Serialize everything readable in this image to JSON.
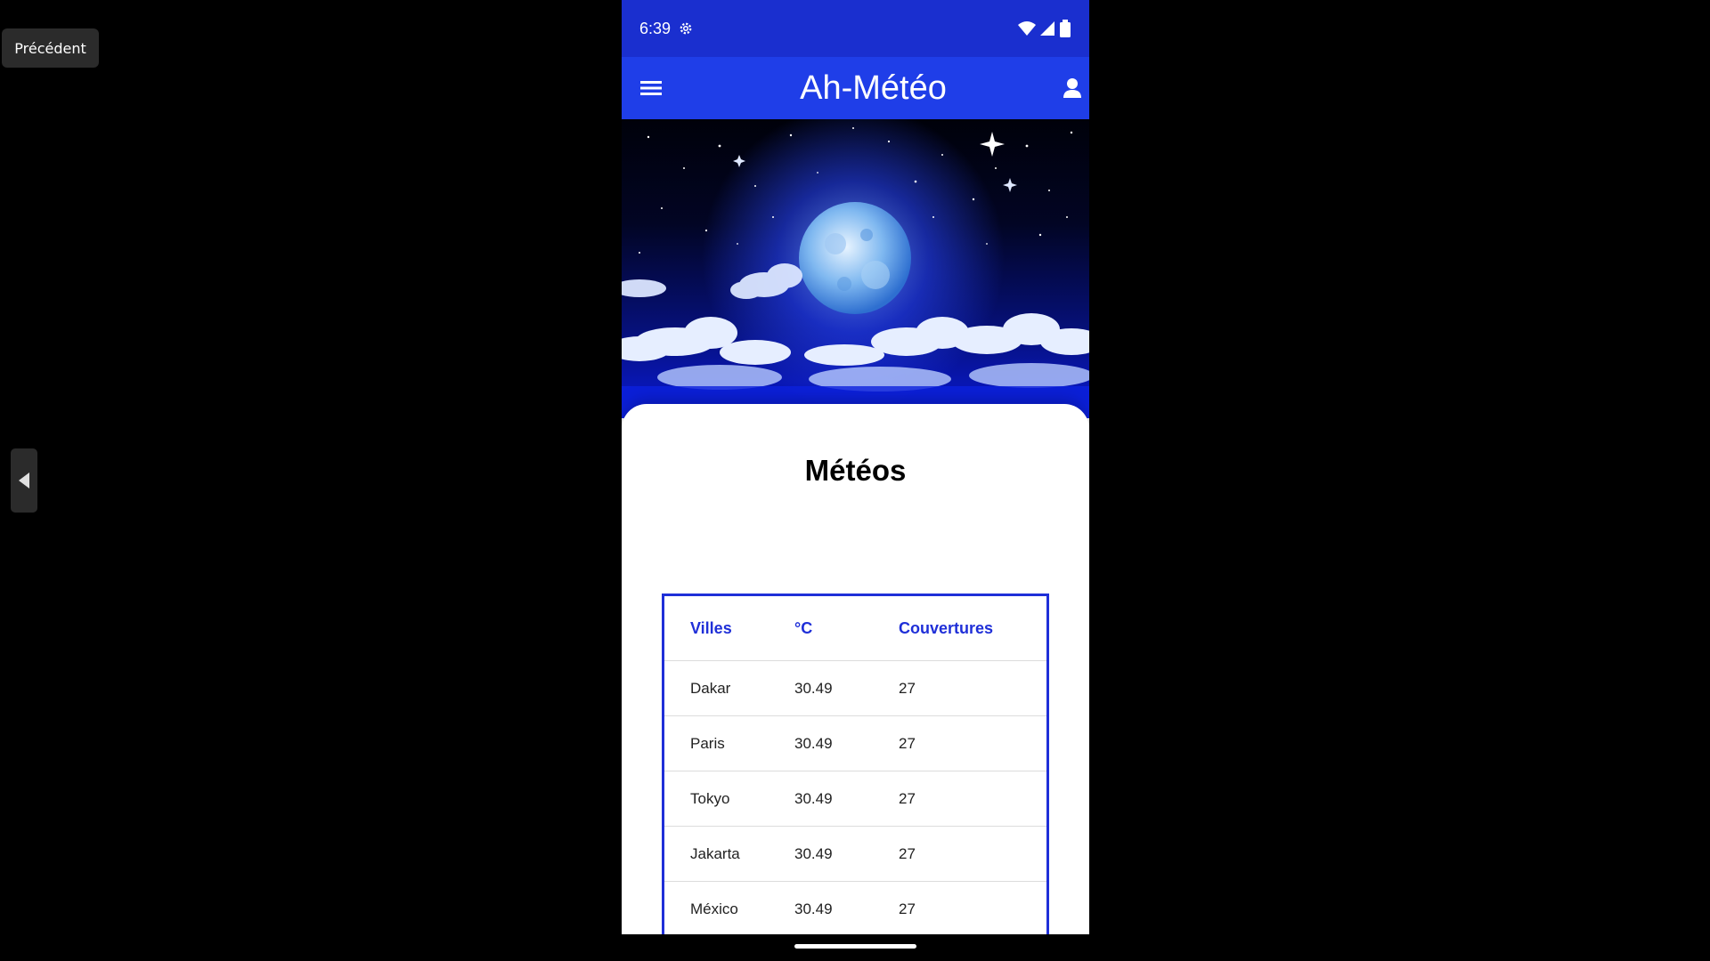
{
  "overlay": {
    "back_tooltip": "Précédent"
  },
  "status_bar": {
    "time": "6:39"
  },
  "app_bar": {
    "title": "Ah-Météo"
  },
  "content": {
    "heading": "Météos",
    "table": {
      "headers": [
        "Villes",
        "°C",
        "Couvertures"
      ],
      "rows": [
        [
          "Dakar",
          "30.49",
          "27"
        ],
        [
          "Paris",
          "30.49",
          "27"
        ],
        [
          "Tokyo",
          "30.49",
          "27"
        ],
        [
          "Jakarta",
          "30.49",
          "27"
        ],
        [
          "México",
          "30.49",
          "27"
        ]
      ]
    }
  },
  "colors": {
    "status_bar": "#1a2fcf",
    "app_bar": "#1f3ee8",
    "table_accent": "#1f2fd8"
  },
  "icons": {
    "status_left": "settings-gear-icon",
    "status_right": [
      "wifi-icon",
      "signal-icon",
      "battery-icon"
    ],
    "menu": "hamburger-menu-icon",
    "user": "user-profile-icon",
    "side_handle": "triangle-left-icon"
  }
}
